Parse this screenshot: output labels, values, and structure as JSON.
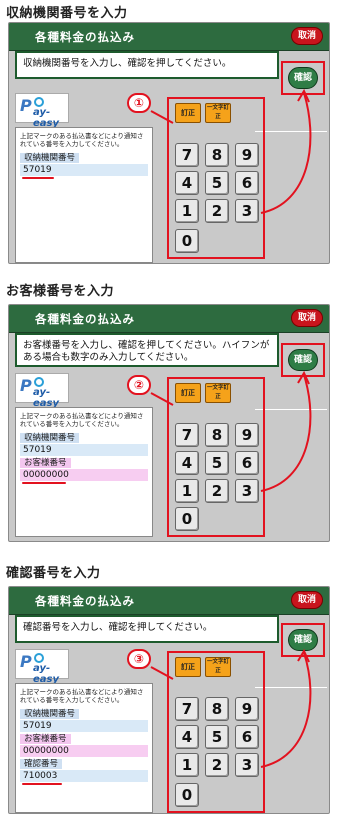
{
  "panel_title": "各種料金の払込み",
  "cancel_label": "取消",
  "confirm_label": "確認",
  "fix_label": "訂正",
  "fix_one_label": "一文字訂正",
  "logo_label": "Pay-easy",
  "info_note": "上記マークのある払込書などにより通知されている番号を入力してください。",
  "keys": [
    "7",
    "8",
    "9",
    "4",
    "5",
    "6",
    "1",
    "2",
    "3",
    "0"
  ],
  "sections": [
    {
      "heading": "収納機関番号を入力",
      "step": "①",
      "instruction": "収納機関番号を入力し、確認を押してください。",
      "fields": [
        {
          "label": "収納機関番号",
          "value": "57019"
        }
      ]
    },
    {
      "heading": "お客様番号を入力",
      "step": "②",
      "instruction": "お客様番号を入力し、確認を押してください。ハイフンがある場合も数字のみ入力してください。",
      "fields": [
        {
          "label": "収納機関番号",
          "value": "57019"
        },
        {
          "label": "お客様番号",
          "value": "00000000"
        }
      ]
    },
    {
      "heading": "確認番号を入力",
      "step": "③",
      "instruction": "確認番号を入力し、確認を押してください。",
      "fields": [
        {
          "label": "収納機関番号",
          "value": "57019"
        },
        {
          "label": "お客様番号",
          "value": "00000000"
        },
        {
          "label": "確認番号",
          "value": "710003"
        }
      ]
    }
  ],
  "colors": {
    "header_green": "#2d6b3f",
    "accent_red": "#e2121f",
    "key_orange": "#f5a21a",
    "field_blue": "#d9e9f7",
    "field_pink": "#f7cdf1"
  }
}
